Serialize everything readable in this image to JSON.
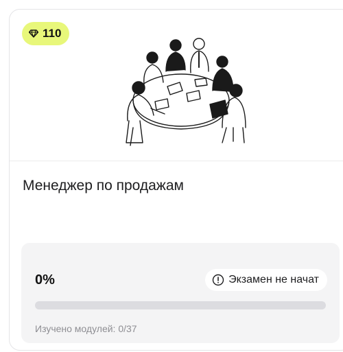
{
  "card": {
    "badge": {
      "icon": "diamond-icon",
      "value": "110"
    },
    "illustration": "team-meeting-illustration",
    "title": "Менеджер по продажам",
    "progress": {
      "percent_label": "0%",
      "fraction": 0,
      "status": {
        "icon": "alert-circle-icon",
        "label": "Экзамен не начат"
      },
      "modules_label": "Изучено модулей: 0/37"
    }
  },
  "colors": {
    "badge_bg": "#e8f77a",
    "panel_bg": "#f4f4f5",
    "bar_track": "#dcdce0"
  }
}
